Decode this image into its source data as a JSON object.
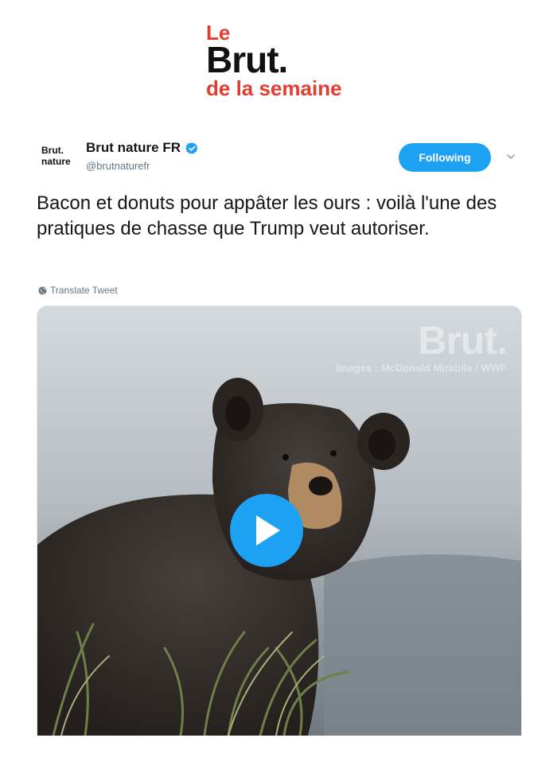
{
  "banner": {
    "line1": "Le",
    "line2": "Brut.",
    "line3": "de la semaine"
  },
  "tweet": {
    "avatar": {
      "line1": "Brut.",
      "line2": "nature"
    },
    "display_name": "Brut nature FR",
    "handle": "@brutnaturefr",
    "follow_label": "Following",
    "text": "Bacon et donuts pour appâter les ours : voilà l'une des pratiques de chasse que Trump veut autoriser.",
    "translate_label": "Translate Tweet",
    "media": {
      "watermark": "Brut.",
      "credit": "Images : McDonald Mirabile / WWF"
    }
  },
  "icons": {
    "verified": "verified-badge-icon",
    "chevron": "chevron-down-icon",
    "globe": "globe-icon",
    "play": "play-icon"
  },
  "colors": {
    "brand_red": "#e43d30",
    "twitter_blue": "#1da1f2",
    "text_dark": "#14171a",
    "text_muted": "#657786"
  }
}
